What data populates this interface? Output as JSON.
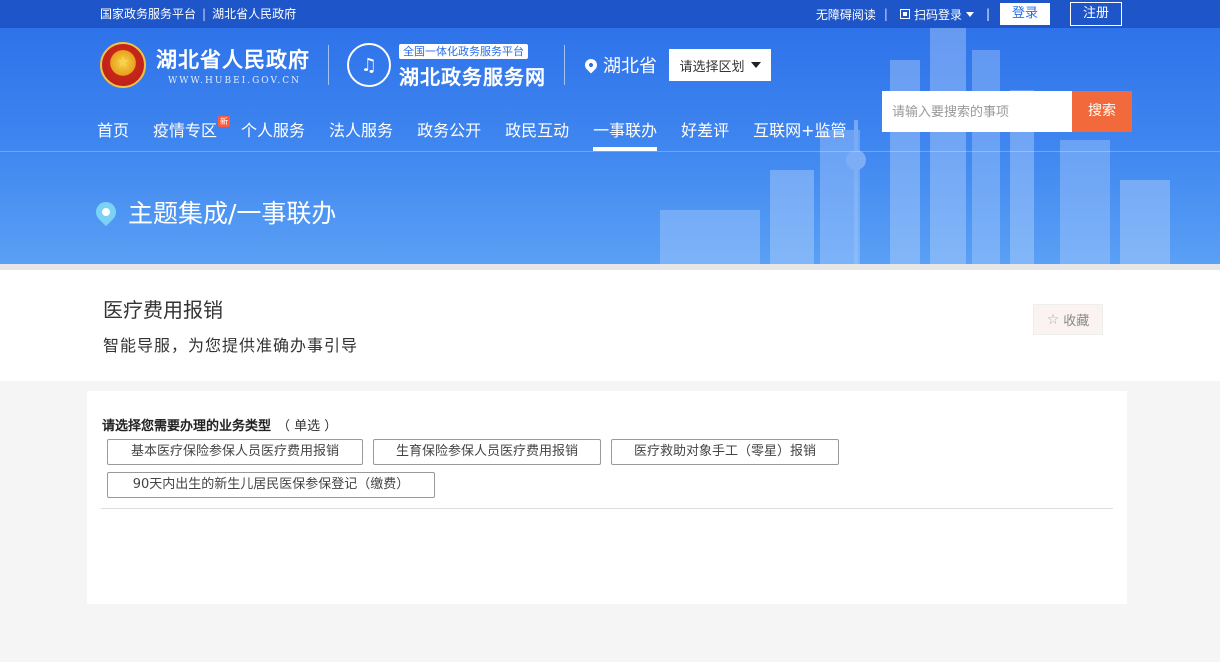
{
  "topbar": {
    "left_a": "国家政务服务平台",
    "left_sep": "|",
    "left_b": "湖北省人民政府",
    "accessible": "无障碍阅读",
    "bar": "|",
    "qr_login": "扫码登录",
    "login": "登录",
    "register": "注册"
  },
  "brand": {
    "gov_name": "湖北省人民政府",
    "gov_url": "WWW.HUBEI.GOV.CN",
    "platform_tag": "全国一体化政务服务平台",
    "platform_name": "湖北政务服务网",
    "province": "湖北省",
    "region_select": "请选择区划"
  },
  "search": {
    "placeholder": "请输入要搜索的事项",
    "button": "搜索"
  },
  "nav": {
    "items": [
      "首页",
      "疫情专区",
      "个人服务",
      "法人服务",
      "政务公开",
      "政民互动",
      "一事联办",
      "好差评",
      "互联网+监管"
    ],
    "badge": "新",
    "active_index": 6
  },
  "breadcrumb": "主题集成/一事联办",
  "page": {
    "title": "医疗费用报销",
    "subtitle": "智能导服，为您提供准确办事引导",
    "favorite": "收藏"
  },
  "question": {
    "label": "请选择您需要办理的业务类型",
    "hint": "（ 单选 ）",
    "options": [
      "基本医疗保险参保人员医疗费用报销",
      "生育保险参保人员医疗费用报销",
      "医疗救助对象手工（零星）报销",
      "90天内出生的新生儿居民医保参保登记（缴费）"
    ]
  },
  "colors": {
    "header_blue": "#2a6ee8",
    "search_orange": "#f2693b"
  }
}
